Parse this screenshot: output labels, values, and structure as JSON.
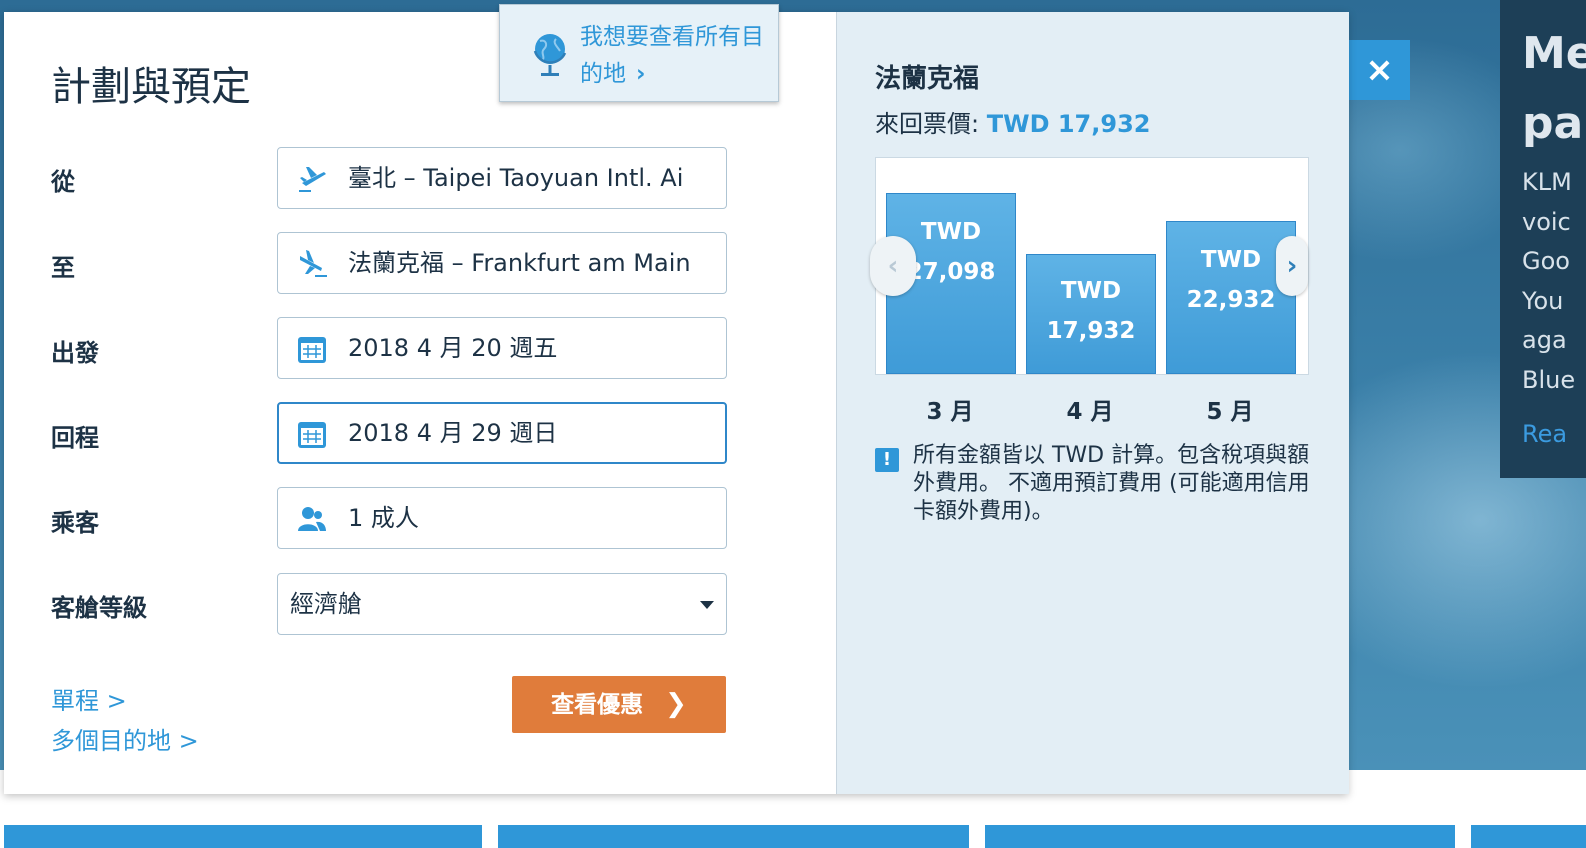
{
  "form": {
    "title": "計劃與預定",
    "all_destinations": "我想要查看所有目的地",
    "from_label": "從",
    "from_value": "臺北 – Taipei Taoyuan Intl. Ai",
    "to_label": "至",
    "to_value": "法蘭克福 – Frankfurt am Main",
    "depart_label": "出發",
    "depart_value": "2018 4 月 20 週五",
    "return_label": "回程",
    "return_value": "2018 4 月 29 週日",
    "passengers_label": "乘客",
    "passengers_value": "1 成人",
    "class_label": "客艙等級",
    "class_value": "經濟艙",
    "one_way_link": "單程 >",
    "multi_city_link": "多個目的地 >",
    "search_button": "查看優惠"
  },
  "close_label": "×",
  "destination": {
    "name": "法蘭克福",
    "price_label": "來回票價:",
    "price_value": "TWD 17,932"
  },
  "chart_data": {
    "type": "bar",
    "categories": [
      "3 月",
      "4 月",
      "5 月"
    ],
    "currency": "TWD",
    "values": [
      27098,
      17932,
      22932
    ],
    "value_labels": [
      "27,098",
      "17,932",
      "22,932"
    ],
    "ylim": [
      0,
      30000
    ],
    "highlight_index": 1
  },
  "notice": "所有金額皆以 TWD 計算。包含稅項與額外費用。 不適用預訂費用 (可能適用信用卡額外費用)。",
  "promo": {
    "title_1": "Me",
    "title_2": "pa",
    "lines": [
      "KLM",
      "voic",
      "Goo",
      "You",
      "aga",
      "Blue"
    ],
    "link": "Rea"
  },
  "colors": {
    "accent": "#2f97d8",
    "cta": "#e07c3b",
    "text": "#1d3245",
    "right_pane": "#e3eef5"
  },
  "icons": {
    "from": "plane-takeoff-icon",
    "to": "plane-landing-icon",
    "calendar": "calendar-icon",
    "passengers": "users-icon",
    "globe": "globe-icon",
    "notice": "info-icon"
  }
}
